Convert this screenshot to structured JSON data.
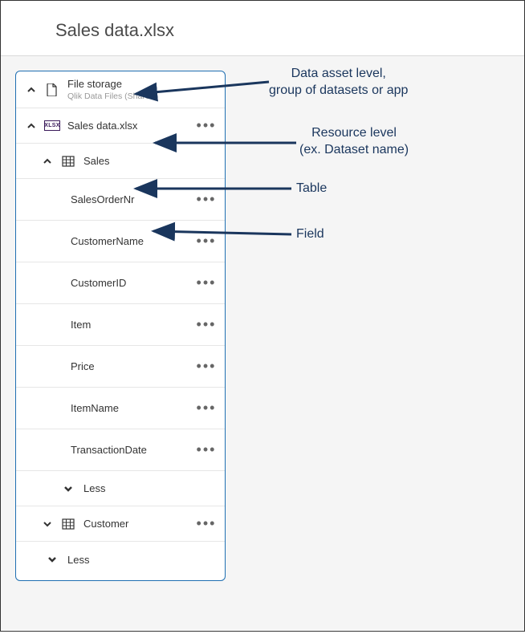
{
  "title": "Sales data.xlsx",
  "asset": {
    "name": "File storage",
    "subtitle": "Qlik Data Files (Shared)"
  },
  "resource": {
    "name": "Sales data.xlsx"
  },
  "table1": {
    "name": "Sales"
  },
  "fields": [
    "SalesOrderNr",
    "CustomerName",
    "CustomerID",
    "Item",
    "Price",
    "ItemName",
    "TransactionDate"
  ],
  "less_label": "Less",
  "table2": {
    "name": "Customer"
  },
  "annotations": {
    "asset": "Data asset level,\ngroup of datasets or app",
    "resource": "Resource level\n(ex. Dataset name)",
    "table": "Table",
    "field": "Field"
  }
}
